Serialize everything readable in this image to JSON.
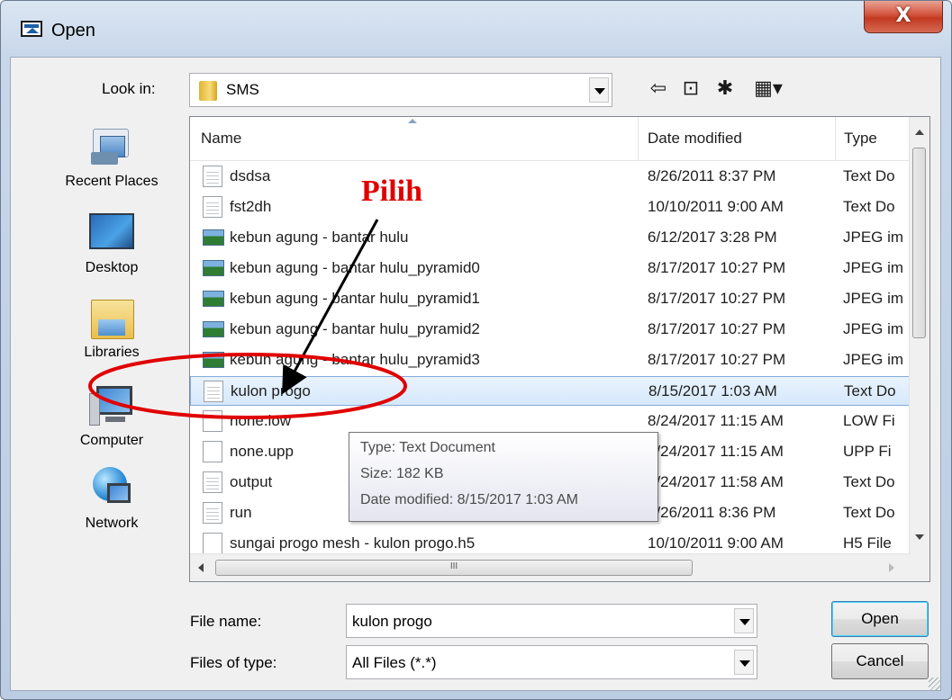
{
  "window": {
    "title": "Open",
    "close_symbol": "X"
  },
  "look_in": {
    "label": "Look in:",
    "value": "SMS"
  },
  "toolbar": {
    "back_symbol": "⇦",
    "up_symbol": "⊡",
    "new_folder_symbol": "✱",
    "view_symbol": "▦▾"
  },
  "places": [
    {
      "label": "Recent Places",
      "icon": "recent-places-icon"
    },
    {
      "label": "Desktop",
      "icon": "desktop-icon"
    },
    {
      "label": "Libraries",
      "icon": "libraries-icon"
    },
    {
      "label": "Computer",
      "icon": "computer-icon"
    },
    {
      "label": "Network",
      "icon": "network-icon"
    }
  ],
  "columns": {
    "name": "Name",
    "date": "Date modified",
    "type": "Type"
  },
  "files": [
    {
      "name": "dsdsa",
      "date": "8/26/2011 8:37 PM",
      "type": "Text Do",
      "icon": "text"
    },
    {
      "name": "fst2dh",
      "date": "10/10/2011 9:00 AM",
      "type": "Text Do",
      "icon": "text"
    },
    {
      "name": "kebun agung - bantar hulu",
      "date": "6/12/2017 3:28 PM",
      "type": "JPEG im",
      "icon": "image"
    },
    {
      "name": "kebun agung - bantar hulu_pyramid0",
      "date": "8/17/2017 10:27 PM",
      "type": "JPEG im",
      "icon": "image"
    },
    {
      "name": "kebun agung - bantar hulu_pyramid1",
      "date": "8/17/2017 10:27 PM",
      "type": "JPEG im",
      "icon": "image"
    },
    {
      "name": "kebun agung - bantar hulu_pyramid2",
      "date": "8/17/2017 10:27 PM",
      "type": "JPEG im",
      "icon": "image"
    },
    {
      "name": "kebun agung - bantar hulu_pyramid3",
      "date": "8/17/2017 10:27 PM",
      "type": "JPEG im",
      "icon": "image"
    },
    {
      "name": "kulon progo",
      "date": "8/15/2017 1:03 AM",
      "type": "Text Do",
      "icon": "text",
      "selected": true
    },
    {
      "name": "none.low",
      "date": "8/24/2017 11:15 AM",
      "type": "LOW Fi",
      "icon": "blank"
    },
    {
      "name": "none.upp",
      "date": "8/24/2017 11:15 AM",
      "type": "UPP Fi",
      "icon": "blank"
    },
    {
      "name": "output",
      "date": "8/24/2017 11:58 AM",
      "type": "Text Do",
      "icon": "text"
    },
    {
      "name": "run",
      "date": "8/26/2011 8:36 PM",
      "type": "Text Do",
      "icon": "text"
    },
    {
      "name": "sungai progo mesh - kulon progo.h5",
      "date": "10/10/2011 9:00 AM",
      "type": "H5 File",
      "icon": "blank"
    }
  ],
  "scrollbar_grip": "III",
  "tooltip": {
    "type": "Type: Text Document",
    "size": "Size: 182 KB",
    "date": "Date modified: 8/15/2017 1:03 AM"
  },
  "file_name": {
    "label": "File name:",
    "value": "kulon progo"
  },
  "file_type": {
    "label": "Files of type:",
    "value": "All Files (*.*)"
  },
  "buttons": {
    "open": "Open",
    "cancel": "Cancel"
  },
  "annotation": {
    "text": "Pilih",
    "color": "#e00000"
  }
}
